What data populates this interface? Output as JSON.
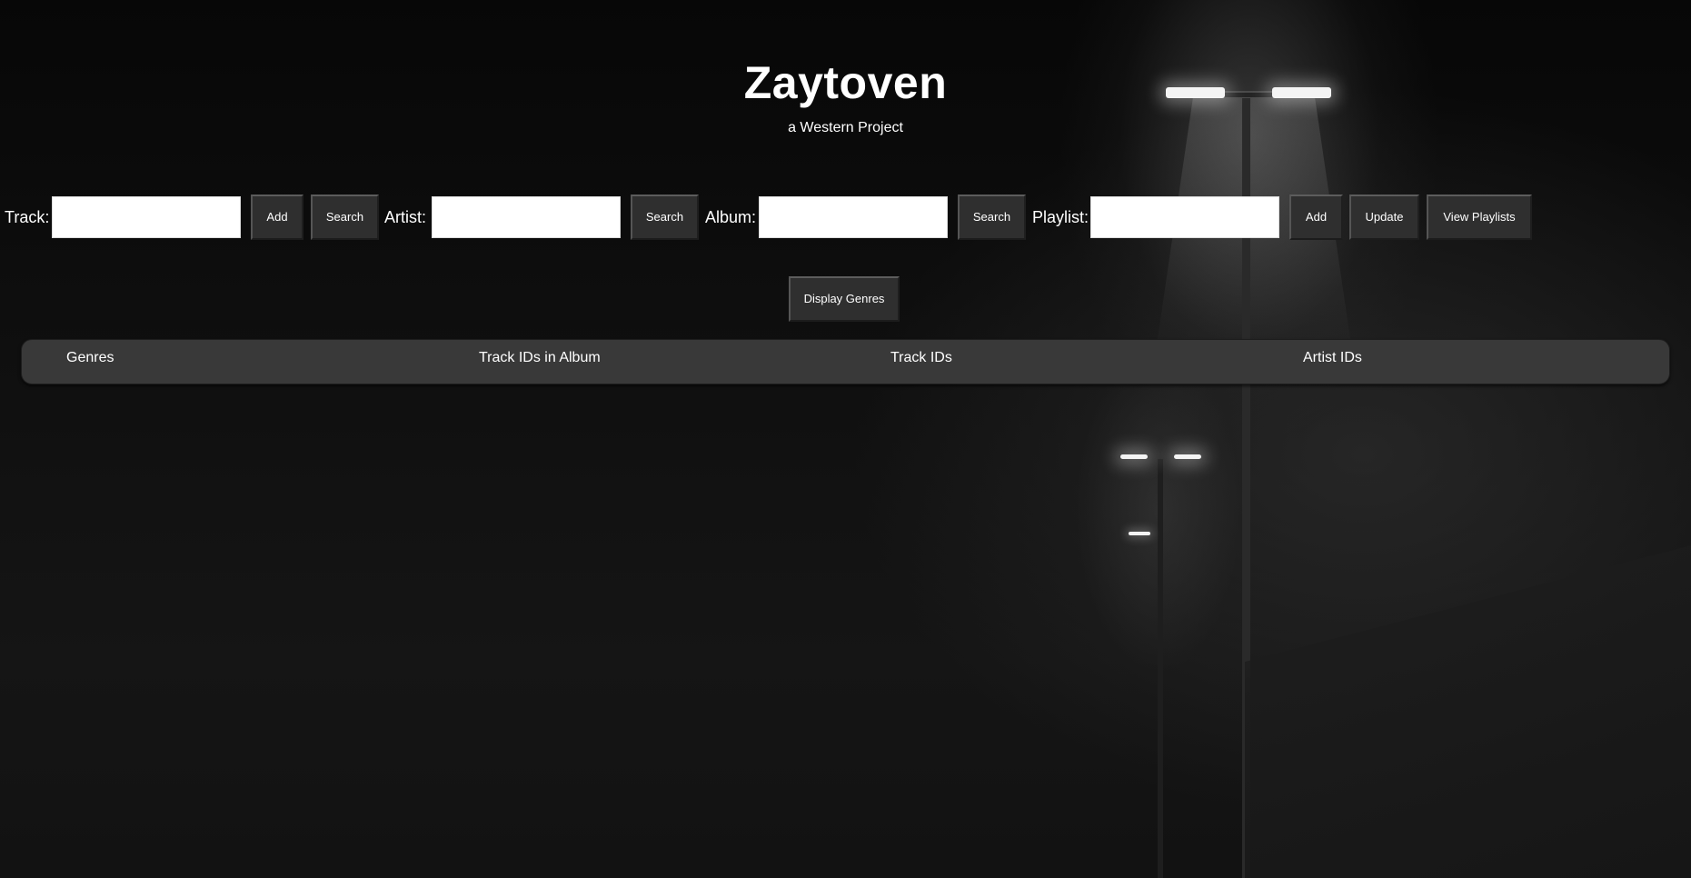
{
  "header": {
    "title": "Zaytoven",
    "subtitle": "a Western Project"
  },
  "track": {
    "label": "Track:",
    "value": "",
    "add_label": "Add",
    "search_label": "Search"
  },
  "artist": {
    "label": "Artist:",
    "value": "",
    "search_label": "Search"
  },
  "album": {
    "label": "Album:",
    "value": "",
    "search_label": "Search"
  },
  "playlist": {
    "label": "Playlist:",
    "value": "",
    "add_label": "Add",
    "update_label": "Update",
    "view_label": "View Playlists"
  },
  "genres_button": {
    "label": "Display Genres"
  },
  "results_table": {
    "columns": [
      "Genres",
      "Track IDs in Album",
      "Track IDs",
      "Artist IDs"
    ]
  },
  "colors": {
    "button_bg": "#2f2f2f",
    "table_header_bg": "#393939",
    "text": "#ffffff"
  }
}
